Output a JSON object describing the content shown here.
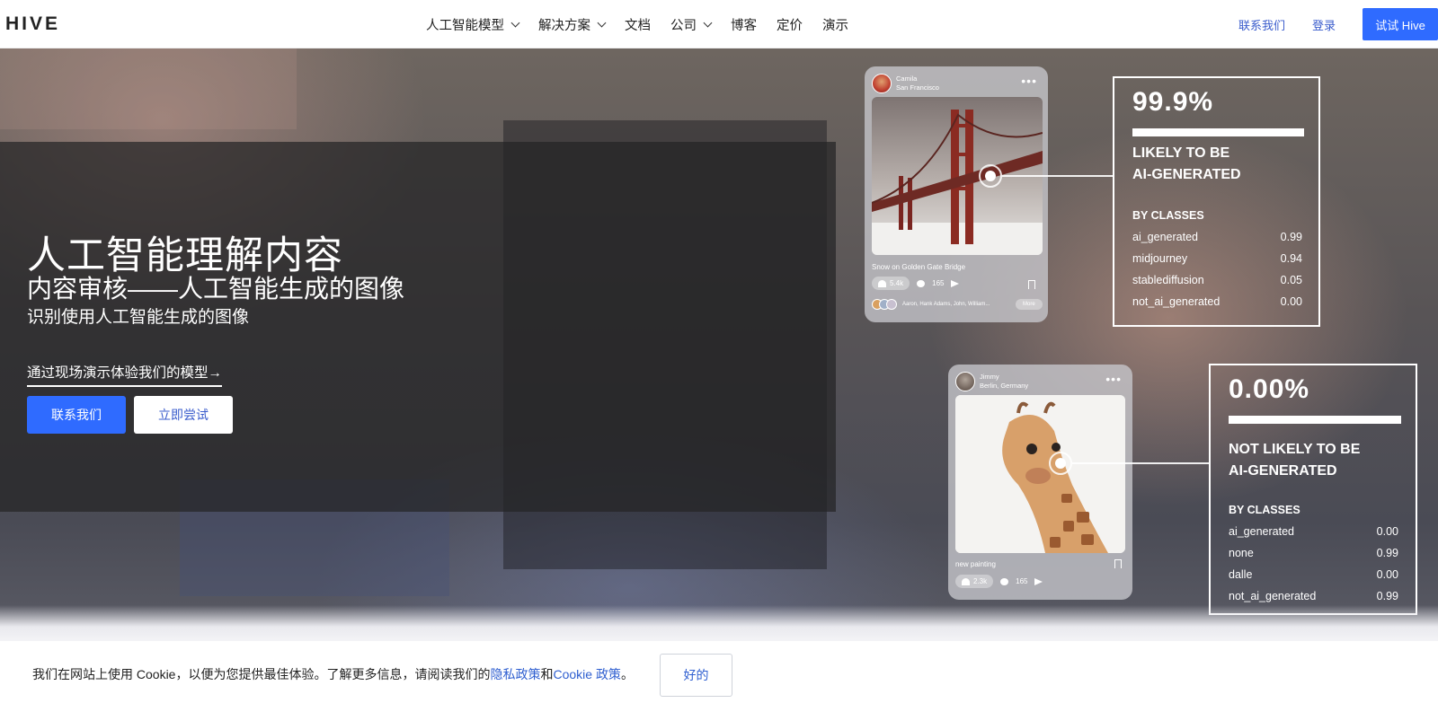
{
  "nav": {
    "logo": "HIVE",
    "menu": [
      {
        "label": "人工智能模型",
        "dropdown": true
      },
      {
        "label": "解决方案",
        "dropdown": true
      },
      {
        "label": "文档",
        "dropdown": false
      },
      {
        "label": "公司",
        "dropdown": true
      },
      {
        "label": "博客",
        "dropdown": false
      },
      {
        "label": "定价",
        "dropdown": false
      },
      {
        "label": "演示",
        "dropdown": false
      }
    ],
    "contact": "联系我们",
    "login": "登录",
    "try": "试试 Hive"
  },
  "hero": {
    "title": "人工智能理解内容",
    "subtitle": "内容审核——人工智能生成的图像",
    "tagline": "识别使用人工智能生成的图像",
    "demo_link": "通过现场演示体验我们的模型→",
    "contact_btn": "联系我们",
    "try_btn": "立即尝试"
  },
  "cards": [
    {
      "user": "Camila",
      "location": "San Francisco",
      "caption": "Snow on Golden Gate Bridge",
      "likes": "5.4k",
      "comments": "165",
      "liked_by": "Aaron, Hank Adams, John, William...",
      "more": "More"
    },
    {
      "user": "Jimmy",
      "location": "Berlin, Germany",
      "caption": "new painting",
      "likes": "2.3k",
      "comments": "165"
    }
  ],
  "results": [
    {
      "percent": "99.9%",
      "bar_fraction": 0.999,
      "verdict_line1": "LIKELY TO BE",
      "verdict_line2": "AI-GENERATED",
      "classes_title": "BY CLASSES",
      "classes": [
        {
          "name": "ai_generated",
          "value": "0.99"
        },
        {
          "name": "midjourney",
          "value": "0.94"
        },
        {
          "name": "stablediffusion",
          "value": "0.05"
        },
        {
          "name": "not_ai_generated",
          "value": "0.00"
        }
      ]
    },
    {
      "percent": "0.00%",
      "bar_fraction": 1.0,
      "verdict_line1": "NOT LIKELY TO BE",
      "verdict_line2": "AI-GENERATED",
      "classes_title": "BY CLASSES",
      "classes": [
        {
          "name": "ai_generated",
          "value": "0.00"
        },
        {
          "name": "none",
          "value": "0.99"
        },
        {
          "name": "dalle",
          "value": "0.00"
        },
        {
          "name": "not_ai_generated",
          "value": "0.99"
        }
      ]
    }
  ],
  "cookie": {
    "text_before": "我们在网站上使用 Cookie，以便为您提供最佳体验。了解更多信息，请阅读我们的",
    "privacy_link": "隐私政策",
    "and": "和",
    "cookie_link": "Cookie 政策",
    "end": "。",
    "ok": "好的"
  },
  "colors": {
    "brand_blue": "#2f6bff",
    "link_blue": "#2f5fd0"
  }
}
